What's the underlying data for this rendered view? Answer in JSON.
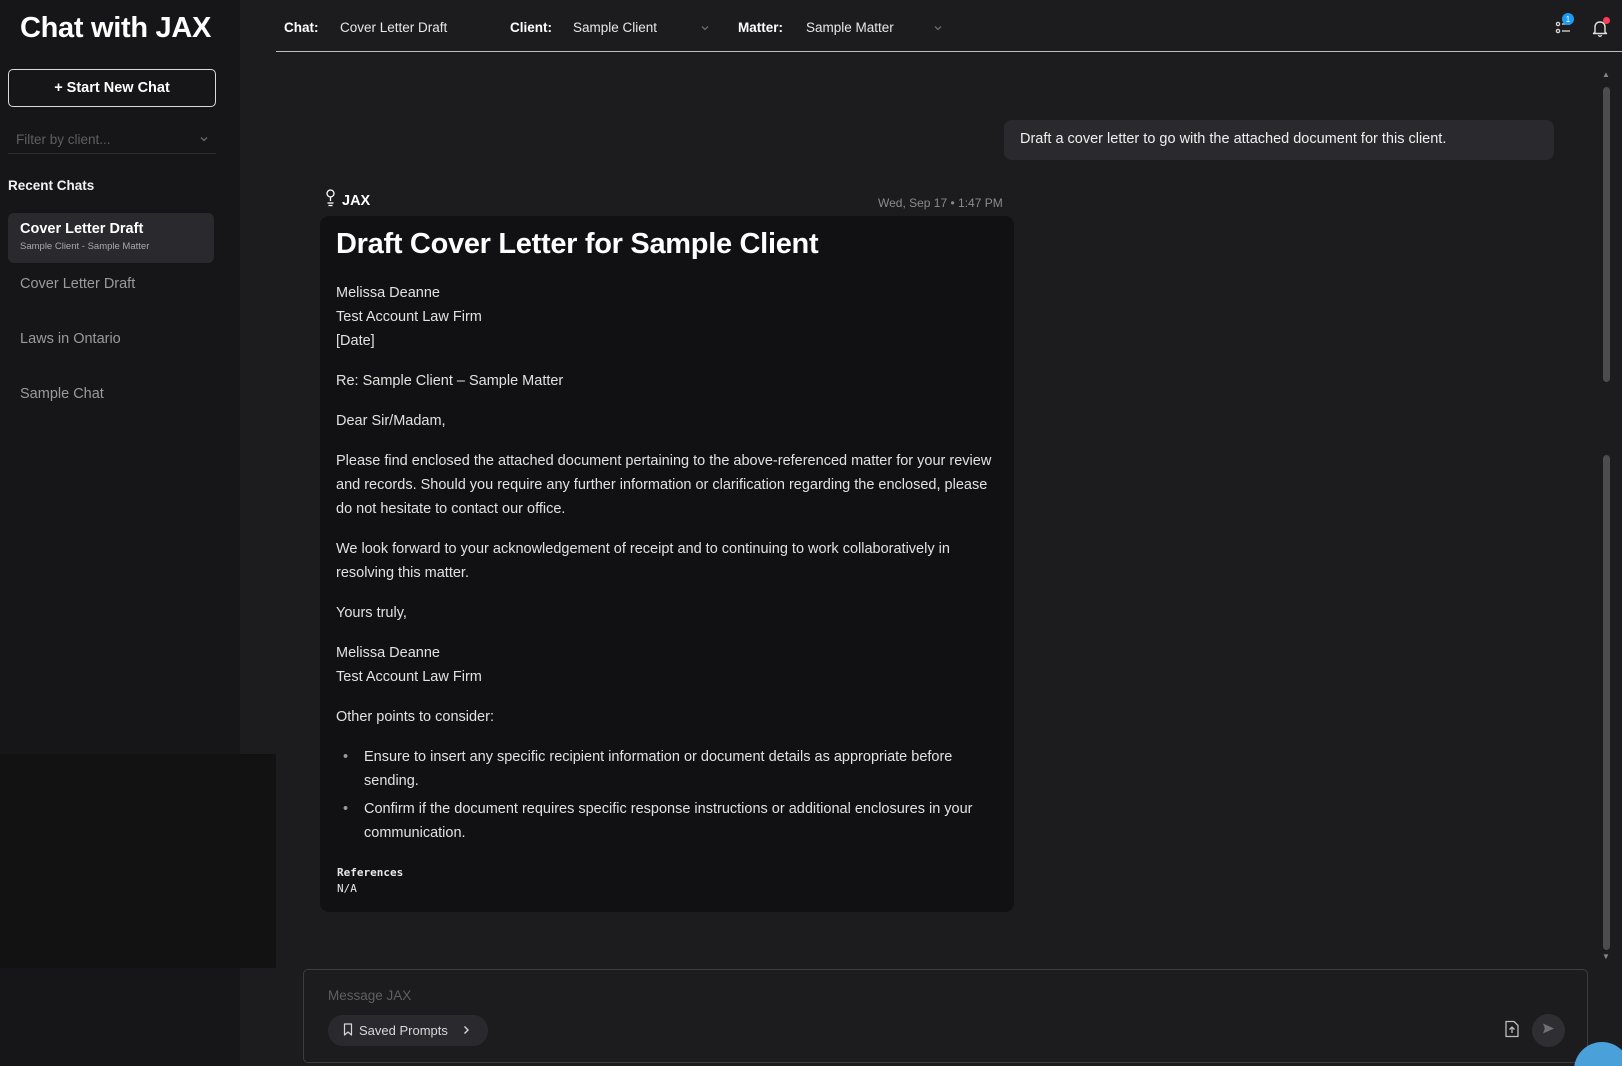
{
  "app": {
    "title": "Chat with JAX"
  },
  "sidebar": {
    "new_chat_label": "+ Start New Chat",
    "filter_placeholder": "Filter by client...",
    "recent_label": "Recent Chats",
    "active_chat": {
      "title": "Cover Letter Draft",
      "subtitle": "Sample Client - Sample Matter"
    },
    "chats": [
      "Cover Letter Draft",
      "Laws in Ontario",
      "Sample Chat"
    ]
  },
  "header": {
    "chat_label": "Chat:",
    "chat_value": "Cover Letter Draft",
    "client_label": "Client:",
    "client_value": "Sample Client",
    "matter_label": "Matter:",
    "matter_value": "Sample Matter",
    "tasks_badge": "1"
  },
  "conversation": {
    "user_message": "Draft a cover letter to go with the attached document for this client.",
    "assistant": {
      "name": "JAX",
      "timestamp": "Wed, Sep 17 • 1:47 PM",
      "heading": "Draft Cover Letter for Sample Client",
      "sender_lines": [
        "Melissa Deanne",
        "Test Account Law Firm",
        "[Date]"
      ],
      "re_line": "Re: Sample Client – Sample Matter",
      "salutation": "Dear Sir/Madam,",
      "paragraph1": "Please find enclosed the attached document pertaining to the above-referenced matter for your review and records. Should you require any further information or clarification regarding the enclosed, please do not hesitate to contact our office.",
      "paragraph2": "We look forward to your acknowledgement of receipt and to continuing to work collaboratively in resolving this matter.",
      "closing": "Yours truly,",
      "signature_lines": [
        "Melissa Deanne",
        "Test Account Law Firm"
      ],
      "other_points_label": "Other points to consider:",
      "bullets": [
        "Ensure to insert any specific recipient information or document details as appropriate before sending.",
        "Confirm if the document requires specific response instructions or additional enclosures in your communication."
      ],
      "references_label": "References",
      "references_value": "N/A"
    }
  },
  "composer": {
    "placeholder": "Message JAX",
    "saved_prompts_label": "Saved Prompts"
  },
  "colors": {
    "background": "#1c1c1f",
    "sidebar": "#161618",
    "card": "#111113",
    "badge": "#1e9bf0",
    "notification_dot": "#ff3b5c"
  }
}
